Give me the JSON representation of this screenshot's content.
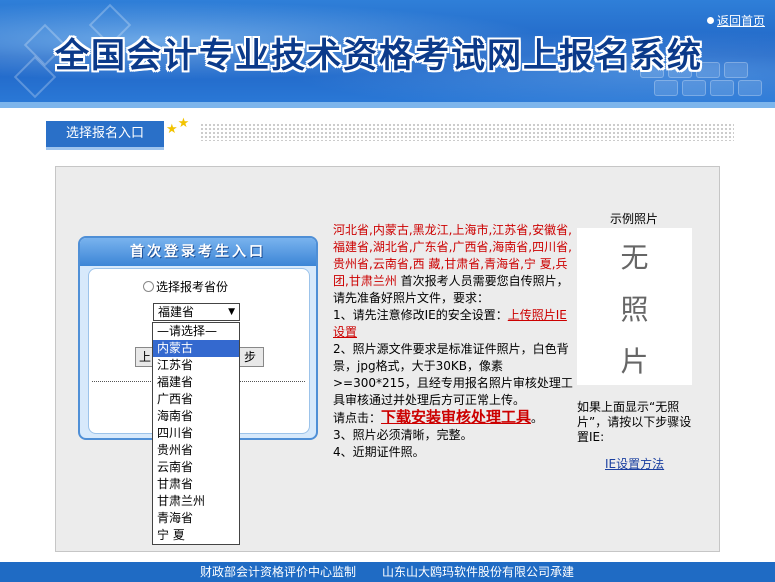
{
  "header": {
    "title": "全国会计专业技术资格考试网上报名系统",
    "home_link": "返回首页"
  },
  "tab": {
    "label": "选择报名入口"
  },
  "login": {
    "title": "首次登录考生入口",
    "radio_label": "选择报考省份",
    "select_value": "福建省",
    "btn_left": "上",
    "btn_right": "步",
    "options": [
      "—请选择—",
      "内蒙古",
      "江苏省",
      "福建省",
      "广西省",
      "海南省",
      "四川省",
      "贵州省",
      "云南省",
      "甘肃省",
      "甘肃兰州",
      "青海省",
      "宁 夏"
    ],
    "selected_index": 1
  },
  "instructions": {
    "provinces": "河北省,内蒙古,黑龙江,上海市,江苏省,安徽省,福建省,湖北省,广东省,广西省,海南省,四川省,贵州省,云南省,西 藏,甘肃省,青海省,宁 夏,兵 团,甘肃兰州",
    "intro": " 首次报考人员需要您自传照片，请先准备好照片文件，要求：",
    "item1_prefix": "1、请先注意修改IE的安全设置：",
    "item1_link": "上传照片IE设置",
    "item2": "2、照片源文件要求是标准证件照片，白色背景，jpg格式，大于30KB，像素>=300*215，且经专用报名照片审核处理工具审核通过并处理后方可正常上传。",
    "click_prefix": "请点击：",
    "download_link": "下载安装审核处理工具",
    "click_suffix": "。",
    "item3": "3、照片必须清晰，完整。",
    "item4": "4、近期证件照。"
  },
  "sample": {
    "caption": "示例照片",
    "photo_text_1": "无",
    "photo_text_2": "照",
    "photo_text_3": "片",
    "note": "如果上面显示“无照片”，请按以下步骤设置IE:",
    "ie_link": "IE设置方法"
  },
  "footer": {
    "left": "财政部会计资格评价中心监制",
    "right": "山东山大鸥玛软件股份有限公司承建"
  }
}
